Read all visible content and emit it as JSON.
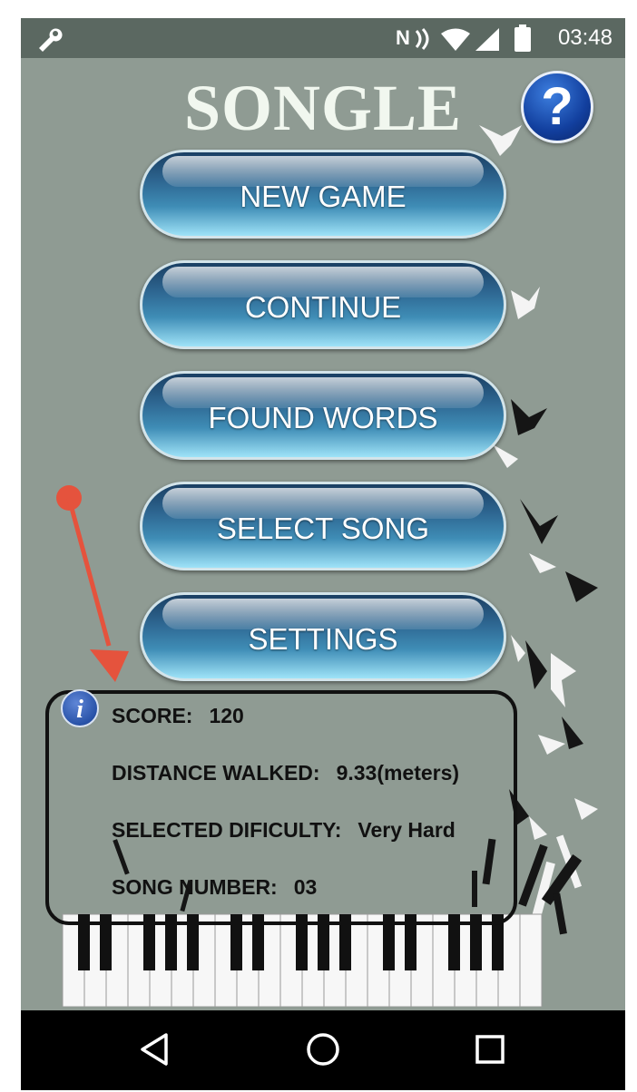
{
  "status_bar": {
    "time": "03:48",
    "nfc_label": "N",
    "icons": [
      "wrench-icon",
      "nfc-icon",
      "wifi-icon",
      "signal-icon",
      "battery-icon"
    ]
  },
  "app": {
    "title": "SONGLE",
    "help_symbol": "?"
  },
  "menu": {
    "new_game": "NEW GAME",
    "continue": "CONTINUE",
    "found_words": "FOUND WORDS",
    "select_song": "SELECT SONG",
    "settings": "SETTINGS"
  },
  "info": {
    "icon_symbol": "i",
    "score_label": "SCORE:",
    "score_value": "120",
    "distance_label": "DISTANCE WALKED:",
    "distance_value": "9.33(meters)",
    "difficulty_label": "SELECTED DIFICULTY:",
    "difficulty_value": "Very Hard",
    "song_label": "SONG NUMBER:",
    "song_value": "03"
  },
  "colors": {
    "background": "#8f9b93",
    "status_bar": "#5b6861",
    "button_blue": "#2e6792",
    "annotation_arrow": "#e5533d",
    "info_border": "#111111"
  }
}
